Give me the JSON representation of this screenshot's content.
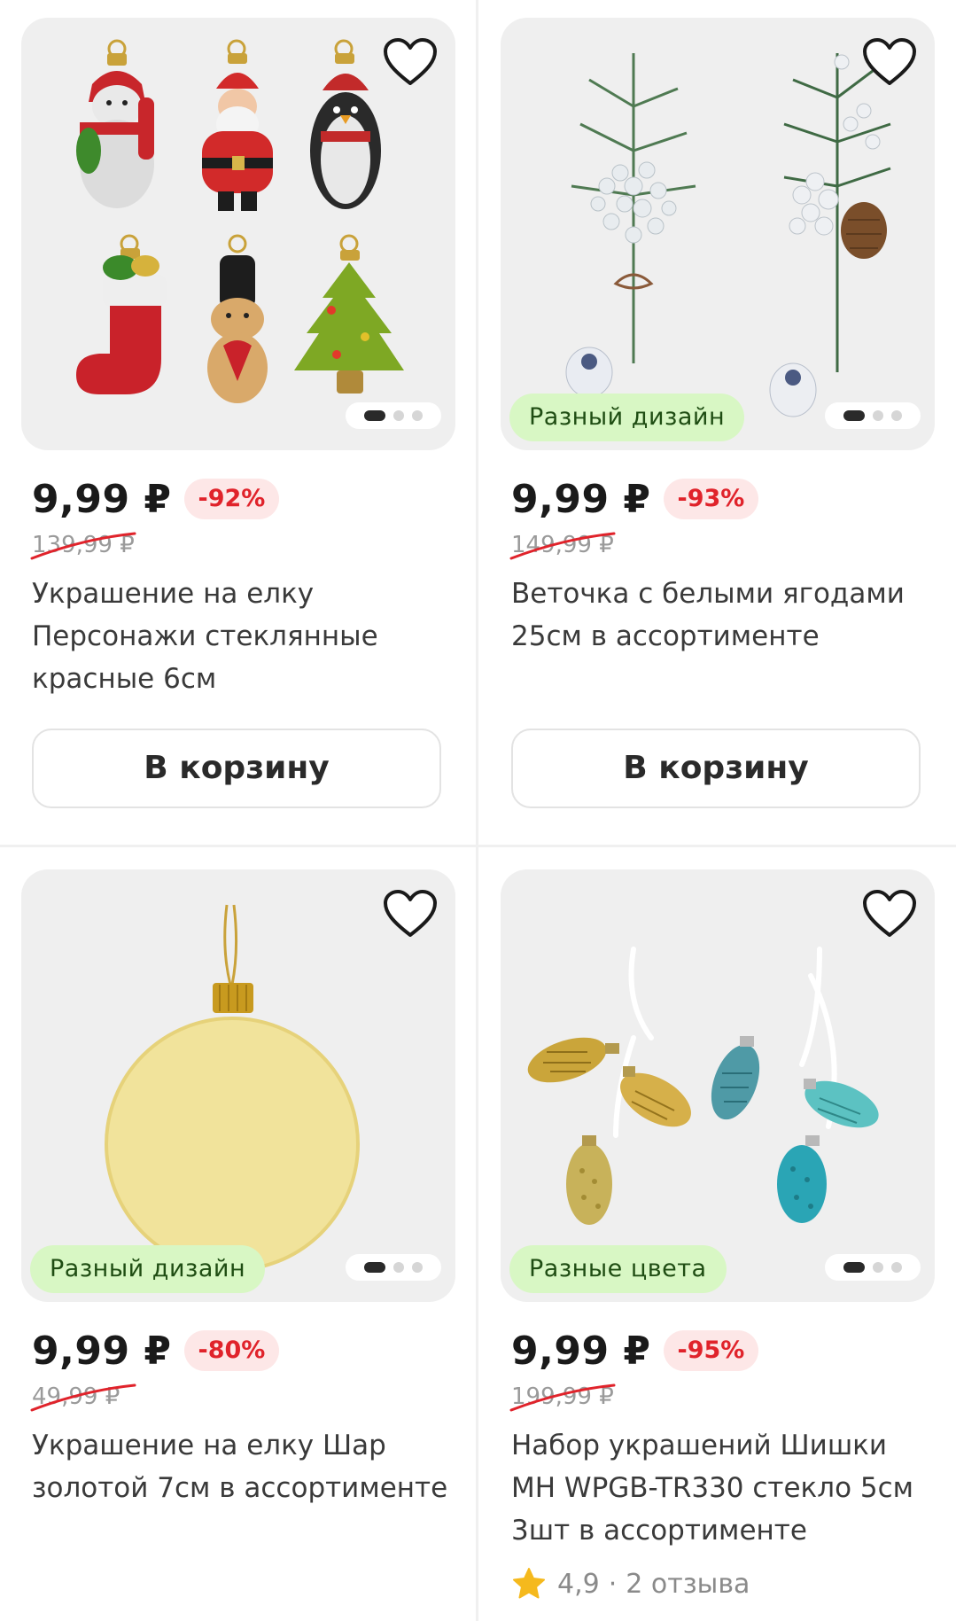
{
  "products": [
    {
      "price": "9,99 ₽",
      "discount": "-92%",
      "old_price": "139,99 ₽",
      "title": "Украшение на елку Персонажи стеклянные красные 6см",
      "cart_label": "В корзину",
      "tag": "",
      "favorite_icon": "heart-outline-icon"
    },
    {
      "price": "9,99 ₽",
      "discount": "-93%",
      "old_price": "149,99 ₽",
      "title": "Веточка с белыми ягодами 25см в ассортименте",
      "cart_label": "В корзину",
      "tag": "Разный дизайн",
      "favorite_icon": "heart-outline-icon"
    },
    {
      "price": "9,99 ₽",
      "discount": "-80%",
      "old_price": "49,99 ₽",
      "title": "Украшение на елку Шар золотой 7см в ассортименте",
      "tag": "Разный дизайн",
      "favorite_icon": "heart-outline-icon"
    },
    {
      "price": "9,99 ₽",
      "discount": "-95%",
      "old_price": "199,99 ₽",
      "title": "Набор украшений Шишки MH WPGB-TR330 стекло 5см 3шт в ассортименте",
      "tag": "Разные цвета",
      "rating": "4,9",
      "reviews": "2 отзыва",
      "favorite_icon": "heart-outline-icon"
    }
  ],
  "carousel": {
    "total_images": 3,
    "active_index": 1
  },
  "colors": {
    "discount_text": "#e0232b",
    "discount_bg": "#fde7e7",
    "tag_bg": "#d8f7c4",
    "tag_text": "#1f4d13",
    "strike": "#e0232b",
    "star": "#f5b91d"
  }
}
